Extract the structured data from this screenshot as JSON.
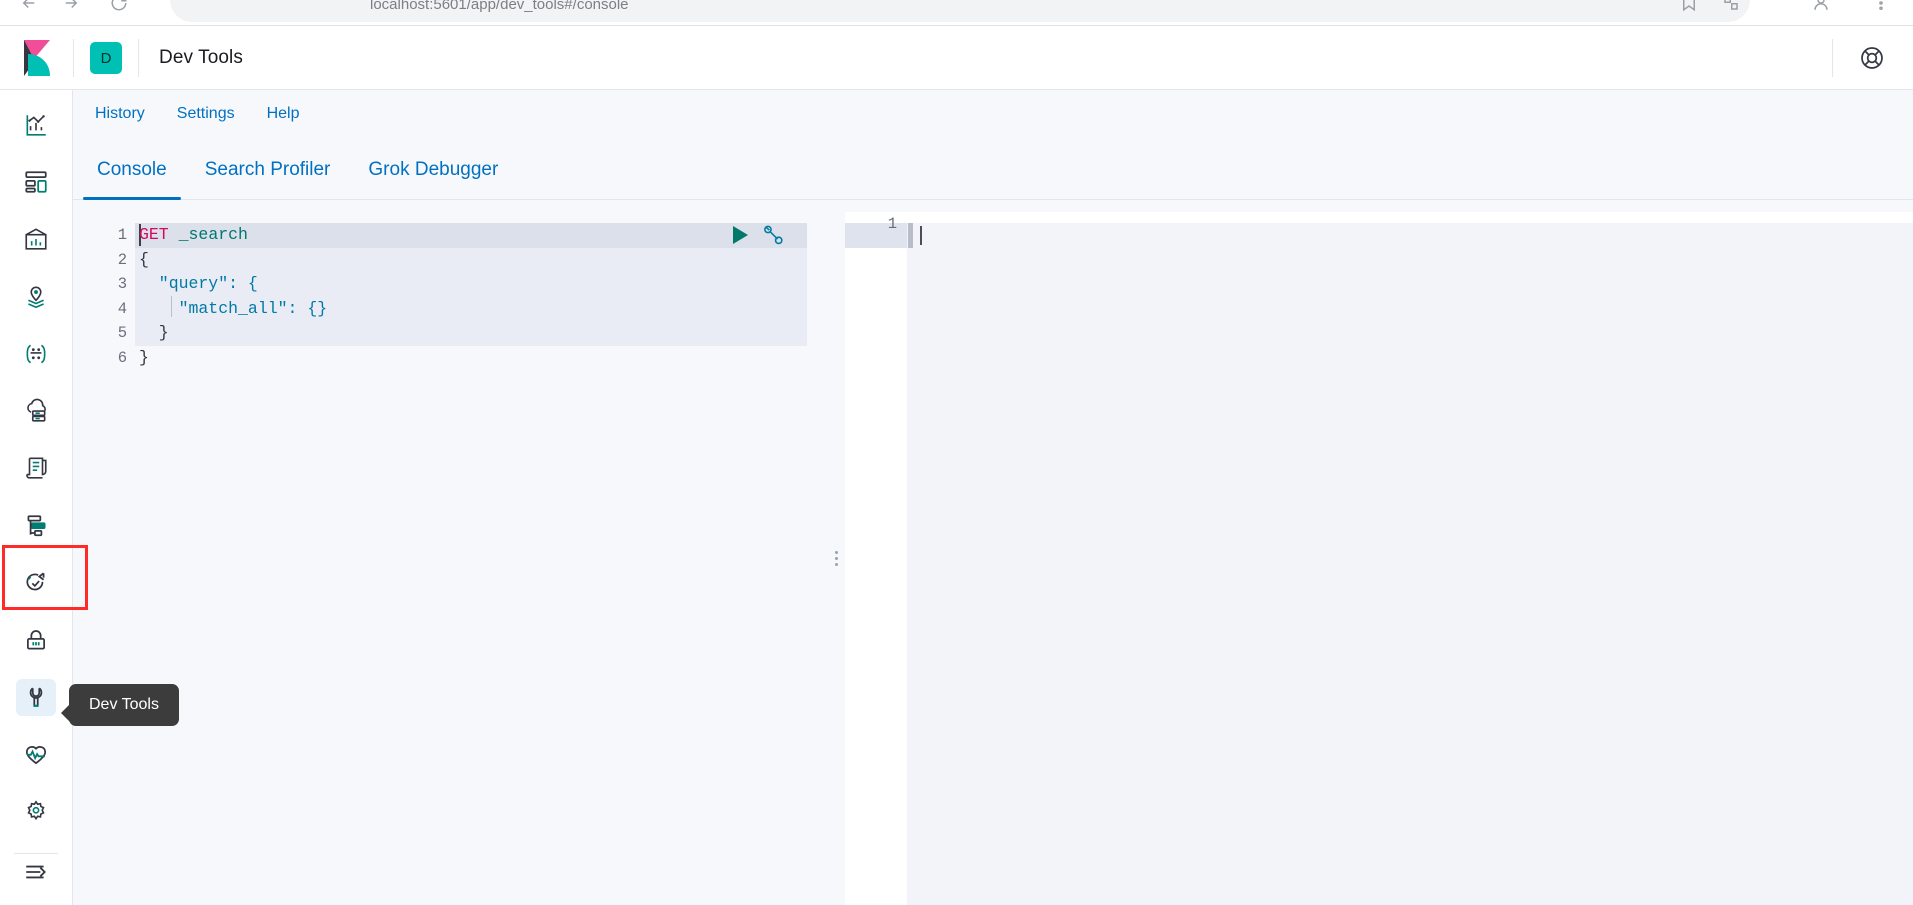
{
  "browser": {
    "omnibox_text": "localhost:5601/app/dev_tools#/console",
    "tab_strip_visible": true
  },
  "header": {
    "logo": "kibana-logo",
    "space_initial": "D",
    "app_title": "Dev Tools",
    "help_icon": "help-ring-icon"
  },
  "sidebar": {
    "items": [
      {
        "name": "analytics-overview",
        "icon": "analytics-chart-icon"
      },
      {
        "name": "dashboards",
        "icon": "dashboard-layout-icon"
      },
      {
        "name": "canvas",
        "icon": "canvas-frame-icon"
      },
      {
        "name": "maps",
        "icon": "map-pin-layers-icon"
      },
      {
        "name": "machine-learning",
        "icon": "ml-nodes-icon"
      },
      {
        "name": "enterprise-search",
        "icon": "cloud-storage-icon"
      },
      {
        "name": "logs",
        "icon": "document-scroll-icon"
      },
      {
        "name": "apm",
        "icon": "apm-trace-icon"
      },
      {
        "name": "uptime",
        "icon": "uptime-check-icon"
      },
      {
        "name": "security",
        "icon": "lock-icon"
      },
      {
        "name": "dev-tools",
        "icon": "wrench-icon",
        "selected": true
      },
      {
        "name": "stack-monitoring",
        "icon": "heartbeat-icon"
      },
      {
        "name": "stack-management",
        "icon": "gear-icon"
      }
    ],
    "collapse": {
      "name": "collapse-nav",
      "icon": "arrow-collapse-icon"
    },
    "tooltip_label": "Dev Tools",
    "annotation_color": "#ff2b27"
  },
  "topnav": {
    "links": [
      {
        "label": "History"
      },
      {
        "label": "Settings"
      },
      {
        "label": "Help"
      }
    ]
  },
  "tabs": [
    {
      "label": "Console",
      "active": true
    },
    {
      "label": "Search Profiler",
      "active": false
    },
    {
      "label": "Grok Debugger",
      "active": false
    }
  ],
  "console": {
    "request_editor": {
      "line_numbers": [
        "1",
        "2",
        "3",
        "4",
        "5",
        "6"
      ],
      "folds": {
        "2": "down",
        "3": "down",
        "5": "up",
        "6": "up"
      },
      "lines": [
        {
          "n": "1",
          "method": "GET",
          "url": " _search"
        },
        {
          "n": "2",
          "text": "{"
        },
        {
          "n": "3",
          "text": "  \"query\": {"
        },
        {
          "n": "4",
          "text": "    \"match_all\": {}"
        },
        {
          "n": "5",
          "text": "  }"
        },
        {
          "n": "6",
          "text": "}"
        }
      ],
      "play_button": "send-request-button",
      "wrench_button": "request-actions-button"
    },
    "response_editor": {
      "line_numbers": [
        "1"
      ],
      "content": ""
    },
    "resizer": "pane-resizer"
  },
  "colors": {
    "accent": "#0071c2",
    "teal": "#00bfb3",
    "method": "#d6085e",
    "url": "#00776f",
    "key": "#0079a5",
    "annotation": "#ff2b27",
    "tooltip_bg": "#3c3c3c"
  }
}
